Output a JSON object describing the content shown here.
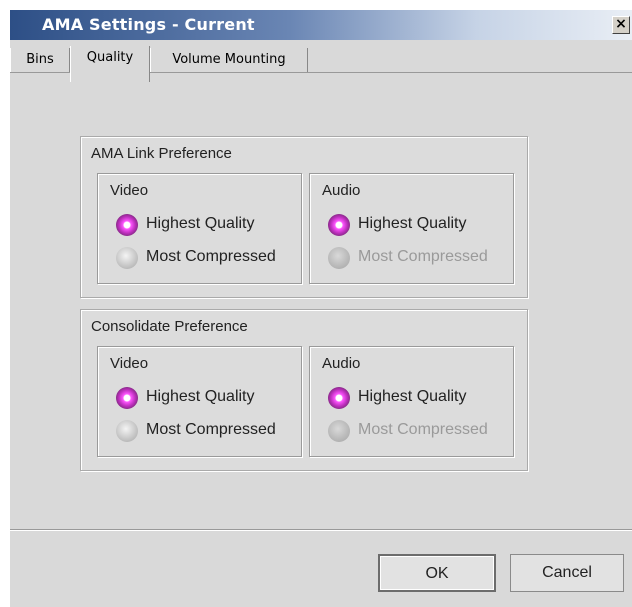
{
  "window": {
    "title": "AMA Settings - Current",
    "close_label": "×"
  },
  "tabs": [
    {
      "label": "Bins"
    },
    {
      "label": "Quality"
    },
    {
      "label": "Volume Mounting"
    }
  ],
  "ama_link_preference": {
    "title": "AMA Link Preference",
    "video": {
      "title": "Video",
      "options": [
        "Highest Quality",
        "Most Compressed"
      ],
      "selected": "Highest Quality"
    },
    "audio": {
      "title": "Audio",
      "options": [
        "Highest Quality",
        "Most Compressed"
      ],
      "selected": "Highest Quality",
      "disabled_option": "Most Compressed"
    }
  },
  "consolidate_preference": {
    "title": "Consolidate Preference",
    "video": {
      "title": "Video",
      "options": [
        "Highest Quality",
        "Most Compressed"
      ],
      "selected": "Highest Quality"
    },
    "audio": {
      "title": "Audio",
      "options": [
        "Highest Quality",
        "Most Compressed"
      ],
      "selected": "Highest Quality",
      "disabled_option": "Most Compressed"
    }
  },
  "buttons": {
    "ok_label": "OK",
    "cancel_label": "Cancel"
  },
  "colors": {
    "titlebar_start": "#2d4f86",
    "radio_selected": "#c030c0",
    "dialog_bg": "#d9d9d9"
  }
}
